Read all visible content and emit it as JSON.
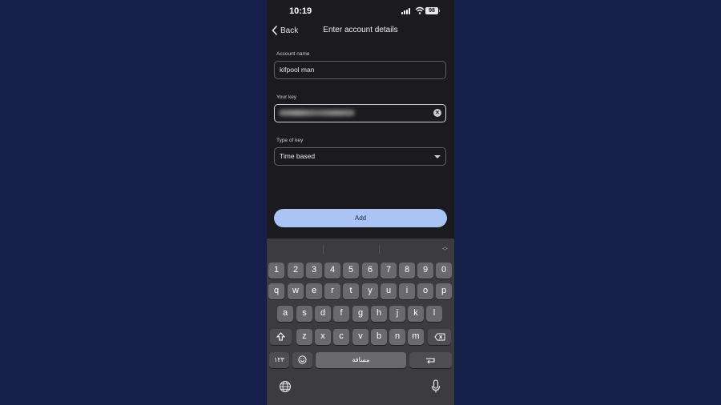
{
  "status_bar": {
    "time": "10:19",
    "battery": "98"
  },
  "header": {
    "back_label": "Back",
    "title": "Enter account details"
  },
  "form": {
    "account_name_label": "Account name",
    "account_name_value": "kifpool man",
    "key_label": "Your key",
    "key_type_label": "Type of key",
    "key_type_value": "Time based"
  },
  "add_button": "Add",
  "keyboard": {
    "row_numbers": [
      "1",
      "2",
      "3",
      "4",
      "5",
      "6",
      "7",
      "8",
      "9",
      "0"
    ],
    "row1": [
      "q",
      "w",
      "e",
      "r",
      "t",
      "y",
      "u",
      "i",
      "o",
      "p"
    ],
    "row2": [
      "a",
      "s",
      "d",
      "f",
      "g",
      "h",
      "j",
      "k",
      "l"
    ],
    "row3": [
      "z",
      "x",
      "c",
      "v",
      "b",
      "n",
      "m"
    ],
    "numbers_key": "١٢٣",
    "space_label": "مسافة"
  },
  "icons": {
    "back": "chevron-left-icon",
    "clear": "clear-icon",
    "dropdown": "chevron-down-icon",
    "shift": "shift-icon",
    "delete": "backspace-icon",
    "emoji": "emoji-icon",
    "return": "return-icon",
    "globe": "globe-icon",
    "mic": "microphone-icon"
  }
}
